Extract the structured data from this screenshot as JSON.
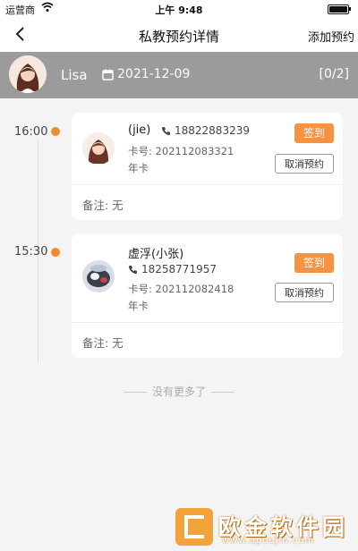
{
  "status_bar": {
    "carrier": "运营商",
    "time": "上午 9:48"
  },
  "nav": {
    "title": "私教预约详情",
    "action": "添加预约"
  },
  "coach": {
    "name": "Lisa",
    "date": "2021-12-09",
    "count": "[0/2]"
  },
  "appointments": [
    {
      "time": "16:00",
      "name": "(jie)",
      "phone": "18822883239",
      "card_no": "卡号: 202112083321",
      "card_type": "年卡",
      "checkin_label": "签到",
      "cancel_label": "取消预约",
      "note": "备注: 无"
    },
    {
      "time": "15:30",
      "name": "虚浮(小张)",
      "phone": "18258771957",
      "card_no": "卡号: 202112082418",
      "card_type": "年卡",
      "checkin_label": "签到",
      "cancel_label": "取消预约",
      "note": "备注: 无"
    }
  ],
  "footer": {
    "no_more": "没有更多了"
  },
  "watermark": {
    "brand": "欧金软件园",
    "url": "www.apoujin.com"
  },
  "colors": {
    "accent": "#f59342",
    "header_gray": "#9b9b9b"
  }
}
